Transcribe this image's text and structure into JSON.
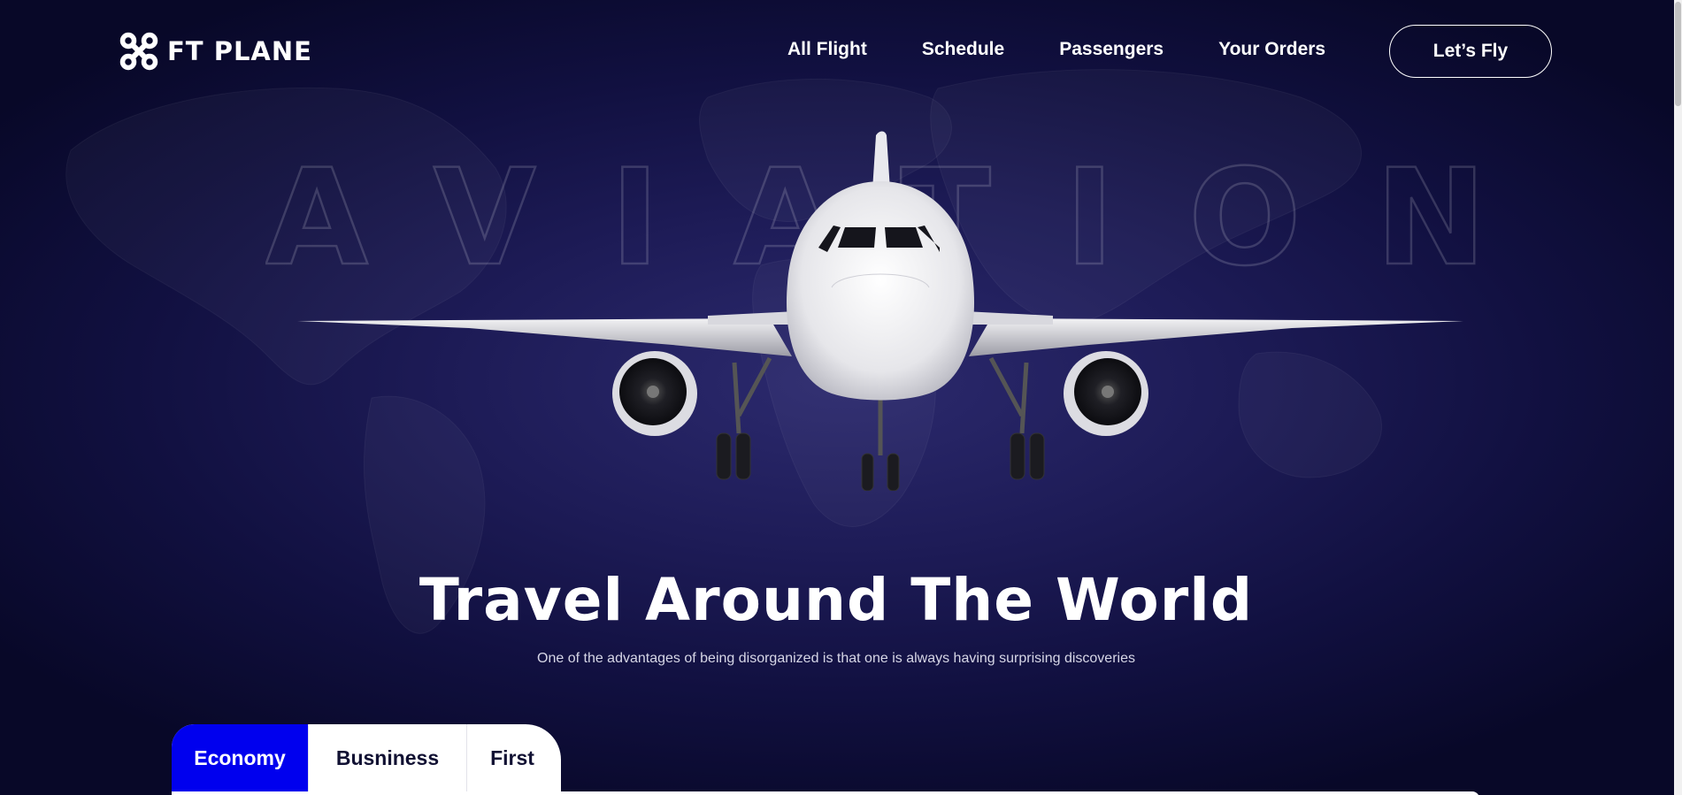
{
  "brand": {
    "name": "FT PLANE",
    "logo_icon": "four-circles-logo-icon"
  },
  "nav": {
    "items": [
      {
        "label": "All Flight"
      },
      {
        "label": "Schedule"
      },
      {
        "label": "Passengers"
      },
      {
        "label": "Your Orders"
      }
    ],
    "cta_label": "Let’s Fly"
  },
  "hero": {
    "background_word": "AVIATION",
    "image": "airplane-front-view",
    "title": "Travel Around The World",
    "subtitle": "One of the advantages of being disorganized is that one is always having surprising discoveries"
  },
  "booking": {
    "tabs": [
      {
        "label": "Economy",
        "active": true
      },
      {
        "label": "Busniness",
        "active": false
      },
      {
        "label": "First",
        "active": false
      }
    ],
    "active_color": "#0000ee"
  },
  "colors": {
    "background": "#1d1b56",
    "text": "#ffffff",
    "accent": "#0000ee"
  }
}
